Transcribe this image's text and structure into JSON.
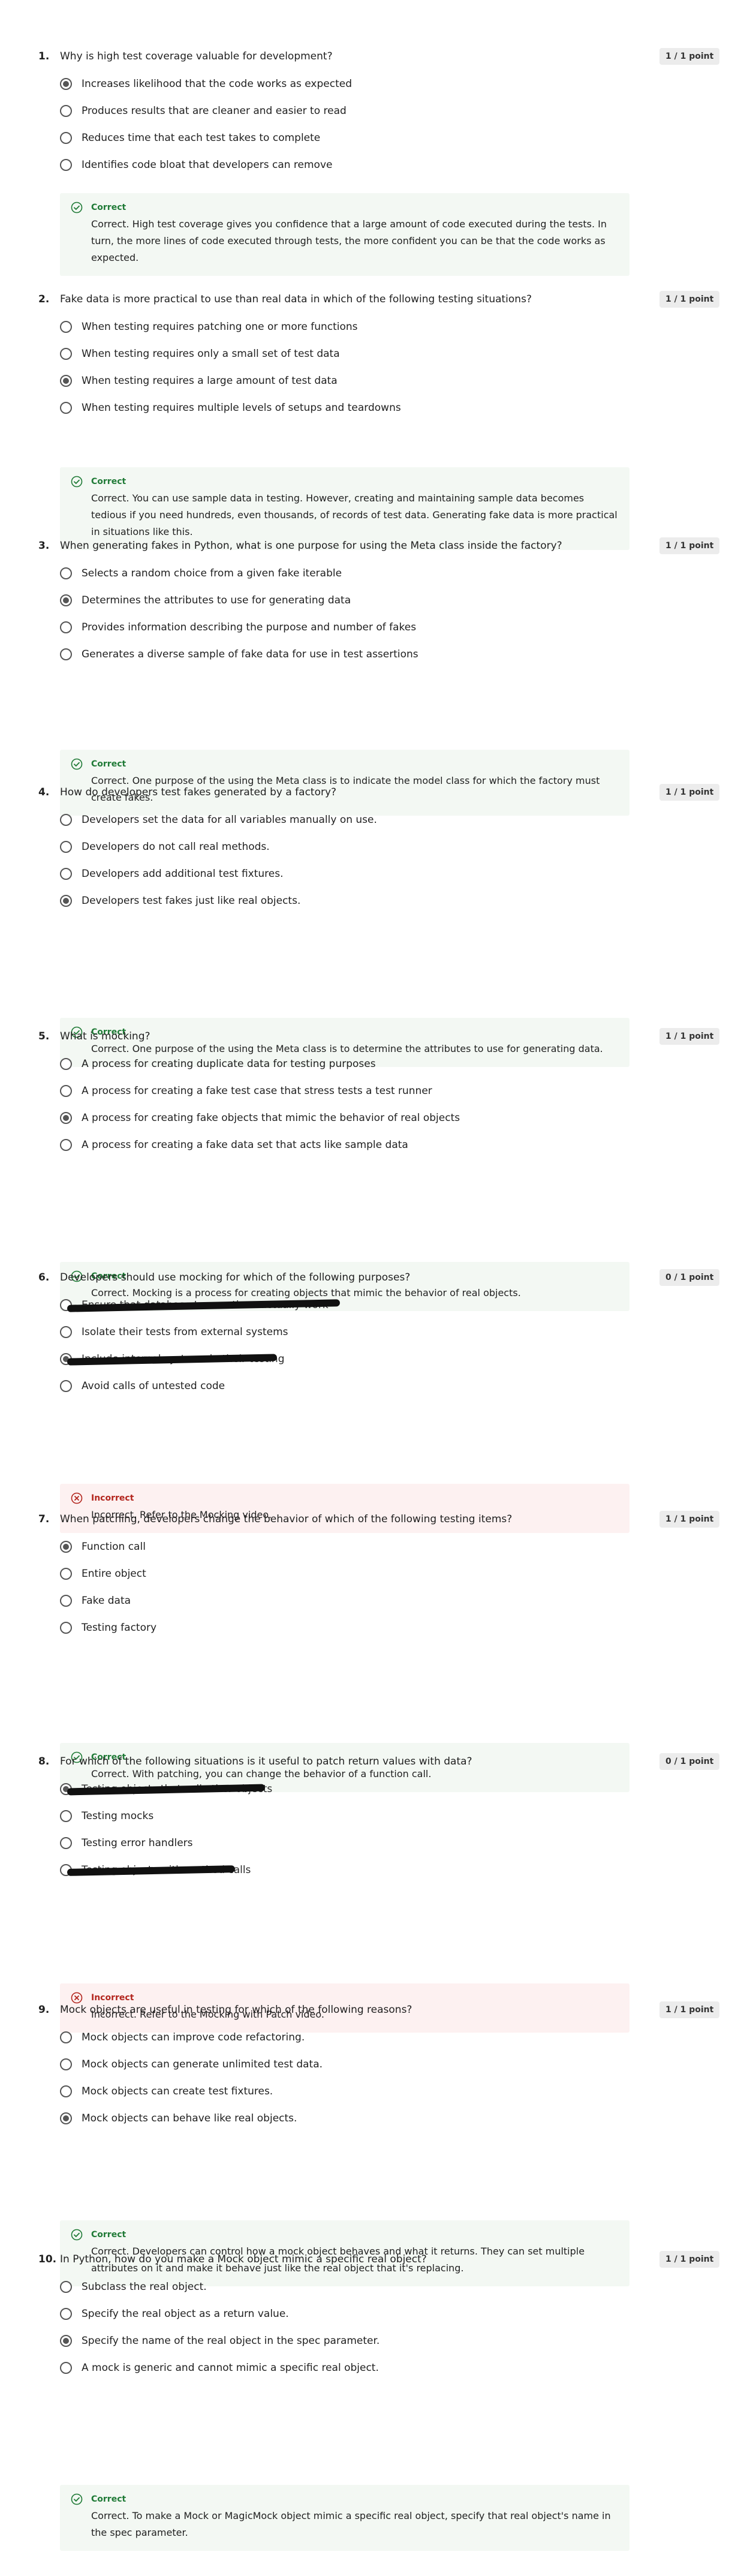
{
  "questions": [
    {
      "number": "1.",
      "text": "Why is high test coverage valuable for development?",
      "points": "1 / 1 point",
      "options": [
        {
          "label": "Increases likelihood that the code works as expected",
          "selected": true
        },
        {
          "label": "Produces results that are cleaner and easier to read",
          "selected": false
        },
        {
          "label": "Reduces time that each test takes to complete",
          "selected": false
        },
        {
          "label": "Identifies code bloat that developers can remove",
          "selected": false
        }
      ],
      "feedback": {
        "status": "correct",
        "heading": "Correct",
        "text": "Correct. High test coverage gives you confidence that a large amount of code executed during the tests. In turn, the more lines of code executed through tests, the more confident you can be that the code works as expected."
      }
    },
    {
      "number": "2.",
      "text": "Fake data is more practical to use than real data in which of the following testing situations?",
      "points": "1 / 1 point",
      "options": [
        {
          "label": "When testing requires patching one or more functions",
          "selected": false
        },
        {
          "label": "When testing requires only a small set of test data",
          "selected": false
        },
        {
          "label": "When testing requires a large amount of test data",
          "selected": true
        },
        {
          "label": "When testing requires multiple levels of setups and teardowns",
          "selected": false
        }
      ],
      "feedback": {
        "status": "correct",
        "heading": "Correct",
        "text": "Correct. You can use sample data in testing. However, creating and maintaining sample data becomes tedious if you need hundreds, even thousands, of records of test data. Generating fake data is more practical in situations like this."
      }
    },
    {
      "number": "3.",
      "text": "When generating fakes in Python, what is one purpose for using the Meta class inside the factory?",
      "points": "1 / 1 point",
      "options": [
        {
          "label": "Selects a random choice from a given fake iterable",
          "selected": false
        },
        {
          "label": "Determines the attributes to use for generating data",
          "selected": true
        },
        {
          "label": "Provides information describing the purpose and number of fakes",
          "selected": false
        },
        {
          "label": "Generates a diverse sample of fake data for use in test assertions",
          "selected": false
        }
      ],
      "feedback": {
        "status": "correct",
        "heading": "Correct",
        "text": "Correct. One purpose of the using the Meta class is to indicate the model class for which the factory must create fakes."
      }
    },
    {
      "number": "4.",
      "text": "How do developers test fakes generated by a factory?",
      "points": "1 / 1 point",
      "options": [
        {
          "label": "Developers set the data for all variables manually on use.",
          "selected": false
        },
        {
          "label": "Developers do not call real methods.",
          "selected": false
        },
        {
          "label": "Developers add additional test fixtures.",
          "selected": false
        },
        {
          "label": "Developers test fakes just like real objects.",
          "selected": true
        }
      ],
      "feedback": {
        "status": "correct",
        "heading": "Correct",
        "text": "Correct. One purpose of the using the Meta class is to determine the attributes to use for generating data."
      }
    },
    {
      "number": "5.",
      "text": "What is mocking?",
      "points": "1 / 1 point",
      "options": [
        {
          "label": "A process for creating duplicate data for testing purposes",
          "selected": false
        },
        {
          "label": "A process for creating a fake test case that stress tests a test runner",
          "selected": false
        },
        {
          "label": "A process for creating fake objects that mimic the behavior of real objects",
          "selected": true
        },
        {
          "label": "A process for creating a fake data set that acts like sample data",
          "selected": false
        }
      ],
      "feedback": {
        "status": "correct",
        "heading": "Correct",
        "text": "Correct. Mocking is a process for creating objects that mimic the behavior of real objects."
      }
    },
    {
      "number": "6.",
      "text": "Developers should use mocking for which of the following purposes?",
      "points": "0 / 1 point",
      "options": [
        {
          "label": "Ensure that database transactions actually work",
          "selected": false,
          "redacted": true
        },
        {
          "label": "Isolate their tests from external systems",
          "selected": false
        },
        {
          "label": "Include internal systems in their testing",
          "selected": true,
          "redacted": true
        },
        {
          "label": "Avoid calls of untested code",
          "selected": false
        }
      ],
      "feedback": {
        "status": "incorrect",
        "heading": "Incorrect",
        "text": "Incorrect. Refer to the Mocking video."
      }
    },
    {
      "number": "7.",
      "text": "When patching, developers change the behavior of which of the following testing items?",
      "points": "1 / 1 point",
      "options": [
        {
          "label": "Function call",
          "selected": true
        },
        {
          "label": "Entire object",
          "selected": false
        },
        {
          "label": "Fake data",
          "selected": false
        },
        {
          "label": "Testing factory",
          "selected": false
        }
      ],
      "feedback": {
        "status": "correct",
        "heading": "Correct",
        "text": "Correct. With patching, you can change the behavior of a function call."
      }
    },
    {
      "number": "8.",
      "text": "For which of the following situations is it useful to patch return values with data?",
      "points": "0 / 1 point",
      "options": [
        {
          "label": "Testing objects that call other objects",
          "selected": true,
          "redacted": true
        },
        {
          "label": "Testing mocks",
          "selected": false
        },
        {
          "label": "Testing error handlers",
          "selected": false
        },
        {
          "label": "Testing objects with method calls",
          "selected": false,
          "redacted": true
        }
      ],
      "feedback": {
        "status": "incorrect",
        "heading": "Incorrect",
        "text": "Incorrect. Refer to the Mocking with Patch video."
      }
    },
    {
      "number": "9.",
      "text": "Mock objects are useful in testing for which of the following reasons?",
      "points": "1 / 1 point",
      "options": [
        {
          "label": "Mock objects can improve code refactoring.",
          "selected": false
        },
        {
          "label": "Mock objects can generate unlimited test data.",
          "selected": false
        },
        {
          "label": "Mock objects can create test fixtures.",
          "selected": false
        },
        {
          "label": "Mock objects can behave like real objects.",
          "selected": true
        }
      ],
      "feedback": {
        "status": "correct",
        "heading": "Correct",
        "text": "Correct. Developers can control how a mock object behaves and what it returns. They can set multiple attributes on it and make it behave just like the real object that it's replacing."
      }
    },
    {
      "number": "10.",
      "text": "In Python, how do you make a Mock object mimic a specific real object?",
      "points": "1 / 1 point",
      "options": [
        {
          "label": "Subclass the real object.",
          "selected": false
        },
        {
          "label": "Specify the real object as a return value.",
          "selected": false
        },
        {
          "label": "Specify the name of the real object in the spec parameter.",
          "selected": true
        },
        {
          "label": "A mock is generic and cannot mimic a specific real object.",
          "selected": false
        }
      ],
      "feedback": {
        "status": "correct",
        "heading": "Correct",
        "text": "Correct. To make a Mock or MagicMock object mimic a specific real object, specify that real object's name in the spec parameter."
      }
    }
  ]
}
